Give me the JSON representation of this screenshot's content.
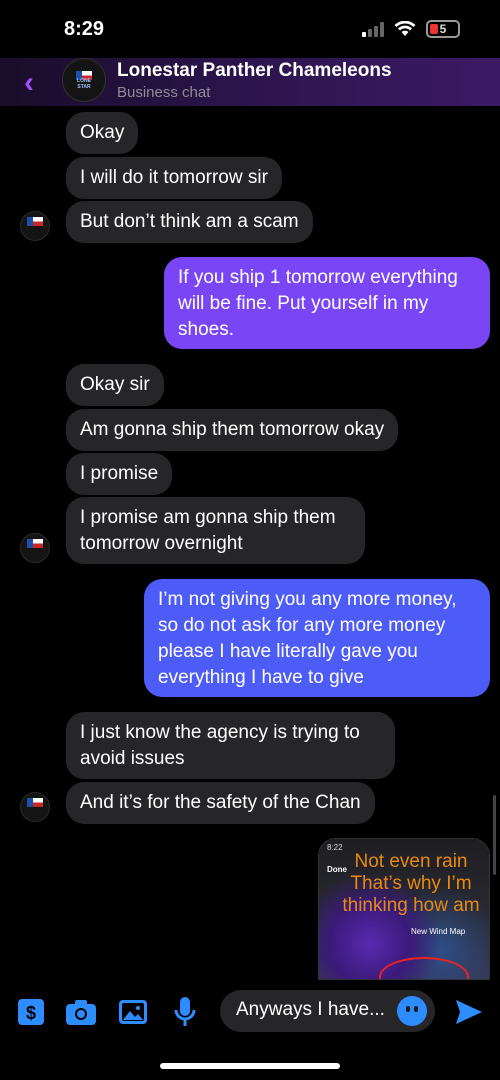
{
  "status": {
    "time": "8:29",
    "battery": "5"
  },
  "header": {
    "title": "Lonestar Panther Chameleons",
    "subtitle": "Business chat",
    "logo_text": "LONE STAR"
  },
  "messages": [
    {
      "dir": "in",
      "text": "Okay"
    },
    {
      "dir": "in",
      "text": "I will do it tomorrow sir"
    },
    {
      "dir": "in",
      "text": "But don’t think am a scam"
    },
    {
      "dir": "out",
      "line1": "If you ship 1 tomorrow everything",
      "line2": "will be fine.  Put yourself in my",
      "line3": "shoes."
    },
    {
      "dir": "in",
      "text": "Okay sir"
    },
    {
      "dir": "in",
      "text": "Am gonna ship them tomorrow okay"
    },
    {
      "dir": "in",
      "text": "I promise"
    },
    {
      "dir": "in",
      "line1": "I promise am gonna ship them",
      "line2": "tomorrow overnight"
    },
    {
      "dir": "out",
      "line1": "I’m not giving you any more money,",
      "line2": "so do not ask for any more money",
      "line3": "please I have literally gave you",
      "line4": "everything I have to give"
    },
    {
      "dir": "in",
      "line1": "I just know the agency is trying to",
      "line2": "avoid issues"
    },
    {
      "dir": "in",
      "text": "And it’s for the safety of the Chan"
    }
  ],
  "image_message": {
    "overlay_text": "Not even rain That’s why I’m thinking how am",
    "map_time": "8:22",
    "map_done": "Done",
    "wind_label": "New Wind Map"
  },
  "composer": {
    "draft": "Anyways I have..."
  },
  "colors": {
    "accent": "#a24cff",
    "bubble_out_purple": "#7a46f5",
    "bubble_out_blue": "#4d5cf6",
    "bubble_in": "#262628",
    "icon_blue": "#2d8cff"
  }
}
